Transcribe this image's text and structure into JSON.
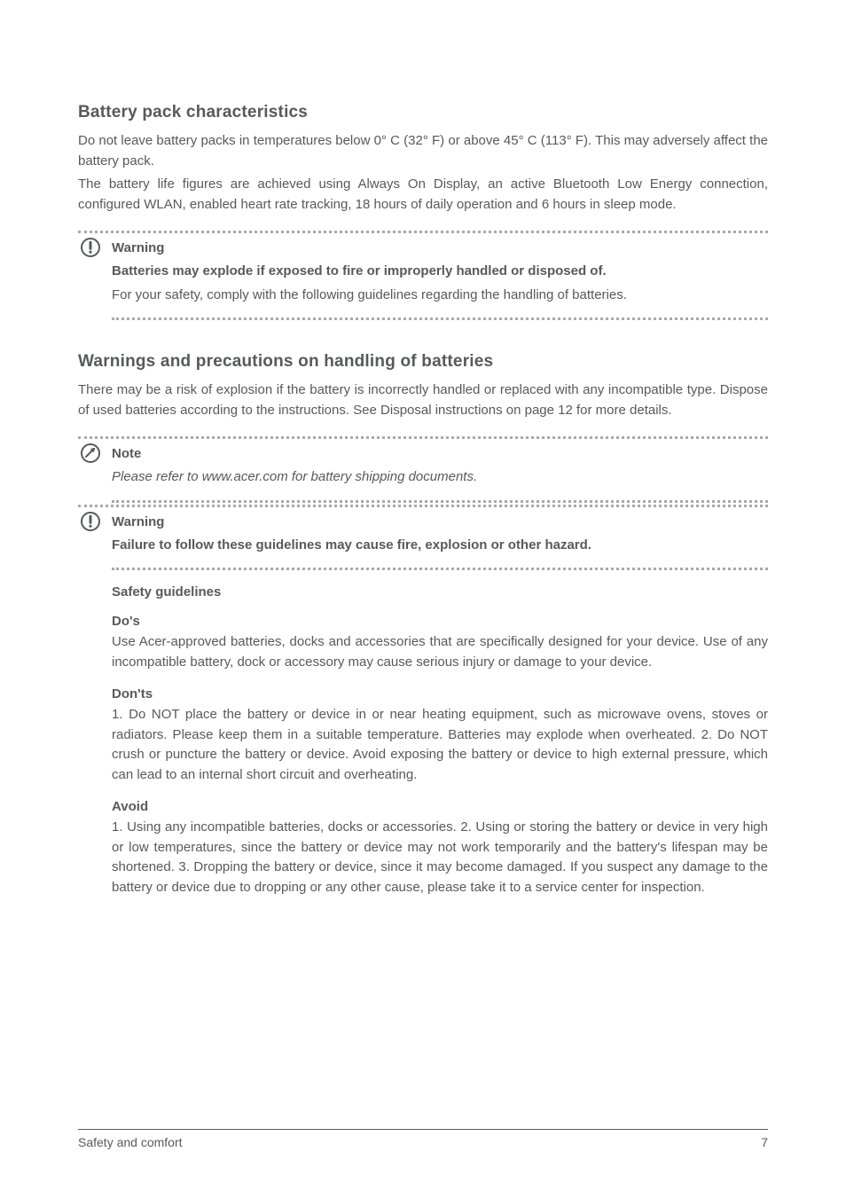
{
  "sec1": {
    "heading": "Battery pack characteristics",
    "p1": "Do not leave battery packs in temperatures below 0° C (32° F) or above 45° C (113° F). This may adversely affect the battery pack.",
    "p2": "The battery life figures are achieved using Always On Display, an active Bluetooth Low Energy connection, configured WLAN, enabled heart rate tracking, 18 hours of daily operation and 6 hours in sleep mode."
  },
  "warn1": {
    "label": "Warning",
    "lead": "Batteries may explode if exposed to fire or improperly handled or disposed of.",
    "end": "For your safety, comply with the following guidelines regarding the handling of batteries."
  },
  "sec2": {
    "heading": "Warnings and precautions on handling of batteries",
    "p": "There may be a risk of explosion if the battery is incorrectly handled or replaced with any incompatible type. Dispose of used batteries according to the instructions. See Disposal instructions on page 12 for more details."
  },
  "note1": {
    "label": "Note",
    "text": "Please refer to www.acer.com for battery shipping documents."
  },
  "warn2": {
    "label": "Warning",
    "lead": "Failure to follow these guidelines may cause fire, explosion or other hazard.",
    "bullets": [
      {
        "h": "Safety guidelines",
        "t": ""
      },
      {
        "h": "Do's",
        "t": "Use Acer-approved batteries, docks and accessories that are specifically designed for your device. Use of any incompatible battery, dock or accessory may cause serious injury or damage to your device."
      },
      {
        "h": "Don'ts",
        "t": "1. Do NOT place the battery or device in or near heating equipment, such as microwave ovens, stoves or radiators. Please keep them in a suitable temperature. Batteries may explode when overheated. 2. Do NOT crush or puncture the battery or device. Avoid exposing the battery or device to high external pressure, which can lead to an internal short circuit and overheating."
      },
      {
        "h": "Avoid",
        "t": "1. Using any incompatible batteries, docks or accessories. 2. Using or storing the battery or device in very high or low temperatures, since the battery or device may not work temporarily and the battery's lifespan may be shortened. 3. Dropping the battery or device, since it may become damaged. If you suspect any damage to the battery or device due to dropping or any other cause, please take it to a service center for inspection."
      }
    ]
  },
  "footer": {
    "left": "Safety and comfort",
    "right": "7"
  }
}
